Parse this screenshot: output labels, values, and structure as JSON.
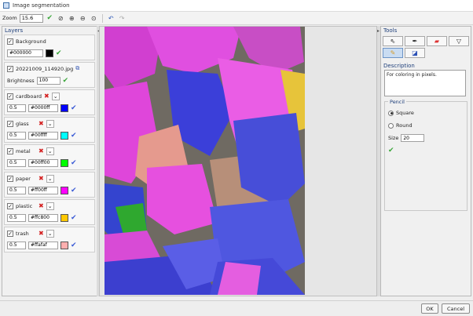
{
  "window": {
    "title": "Image segmentation"
  },
  "toolbar": {
    "zoom_label": "Zoom",
    "zoom_value": "15.6"
  },
  "layers_panel": {
    "title": "Layers",
    "background": {
      "label": "Background",
      "color_hex": "#000000",
      "swatch_color": "#000000"
    },
    "image": {
      "filename": "20221009_114920.jpg",
      "brightness_label": "Brightness",
      "brightness_value": "100"
    },
    "classes": [
      {
        "name": "cardboard",
        "opacity": "0.5",
        "color_hex": "#0000ff",
        "swatch_color": "#0000ff"
      },
      {
        "name": "glass",
        "opacity": "0.5",
        "color_hex": "#00ffff",
        "swatch_color": "#00ffff"
      },
      {
        "name": "metal",
        "opacity": "0.5",
        "color_hex": "#00ff00",
        "swatch_color": "#00ff00"
      },
      {
        "name": "paper",
        "opacity": "0.5",
        "color_hex": "#ff00ff",
        "swatch_color": "#ff00ff"
      },
      {
        "name": "plastic",
        "opacity": "0.5",
        "color_hex": "#ffc800",
        "swatch_color": "#ffc800"
      },
      {
        "name": "trash",
        "opacity": "0.5",
        "color_hex": "#ffafaf",
        "swatch_color": "#ffafaf"
      }
    ]
  },
  "tools_panel": {
    "title": "Tools",
    "description_label": "Description",
    "description_text": "For coloring in pixels.",
    "pencil": {
      "title": "Pencil",
      "shape_square": "Square",
      "shape_round": "Round",
      "size_label": "Size",
      "size_value": "20"
    }
  },
  "footer": {
    "ok_label": "OK",
    "cancel_label": "Cancel"
  },
  "icons": [
    "app-icon",
    "confirm-check-icon",
    "fit-icon",
    "zoom-in-icon",
    "zoom-out-icon",
    "zoom-reset-icon",
    "undo-icon",
    "redo-icon",
    "delete-x-icon",
    "dropdown-chevron-icon",
    "apply-check-icon",
    "copy-icon",
    "cursor-icon",
    "pen-icon",
    "eraser-icon",
    "lasso-icon",
    "pencil-icon",
    "fill-icon"
  ]
}
